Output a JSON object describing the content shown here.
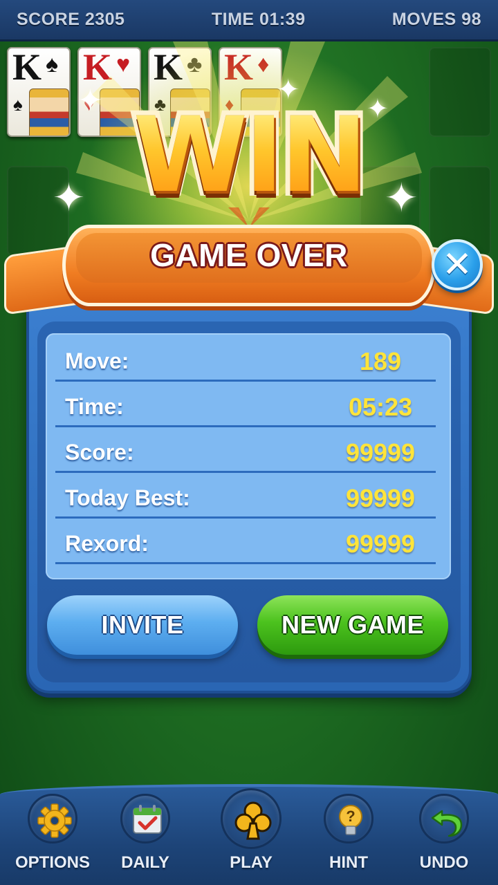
{
  "topbar": {
    "score": "SCORE 2305",
    "time": "TIME 01:39",
    "moves": "MOVES 98"
  },
  "foundation_cards": [
    {
      "rank": "K",
      "suit": "♠",
      "color": "black"
    },
    {
      "rank": "K",
      "suit": "♥",
      "color": "red"
    },
    {
      "rank": "K",
      "suit": "♣",
      "color": "black"
    },
    {
      "rank": "K",
      "suit": "♦",
      "color": "red"
    }
  ],
  "dialog": {
    "headline": "WIN",
    "title": "GAME OVER",
    "close_icon": "✕",
    "stats": [
      {
        "label": "Move:",
        "value": "189"
      },
      {
        "label": "Time:",
        "value": "05:23"
      },
      {
        "label": "Score:",
        "value": "99999"
      },
      {
        "label": "Today Best:",
        "value": "99999"
      },
      {
        "label": "Rexord:",
        "value": "99999"
      }
    ],
    "invite_label": "INVITE",
    "new_game_label": "NEW GAME"
  },
  "bottom_nav": [
    {
      "label": "OPTIONS",
      "icon": "gear-icon"
    },
    {
      "label": "DAILY",
      "icon": "calendar-check-icon"
    },
    {
      "label": "PLAY",
      "icon": "club-icon"
    },
    {
      "label": "HINT",
      "icon": "lightbulb-question-icon"
    },
    {
      "label": "UNDO",
      "icon": "undo-arrow-icon"
    }
  ],
  "colors": {
    "table_green": "#1e6d22",
    "panel_blue": "#2a66b4",
    "stat_value": "#ffe43a",
    "ribbon_orange": "#f07d22",
    "new_game_green": "#4cc21e",
    "invite_blue": "#5daef0"
  }
}
